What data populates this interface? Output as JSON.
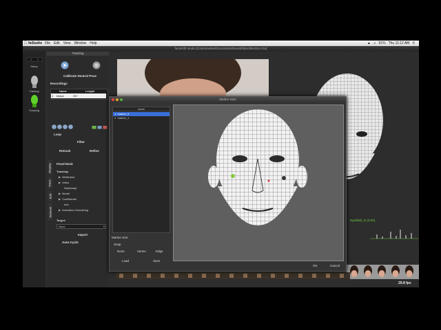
{
  "menubar": {
    "app_name": "faStudio",
    "items": [
      "File",
      "Edit",
      "View",
      "Window",
      "Help"
    ],
    "status_battery": "91%",
    "status_clock": "Thu 11:12 AM"
  },
  "window": {
    "title": "faceshift studio [/Users/weise/Documents/faceshift/profiles/Doc.fsu]"
  },
  "toolbar": {
    "setup_label": "Setup",
    "training_label": "Training",
    "tracking_label": "Tracking"
  },
  "tracking_panel": {
    "header": "Tracking",
    "calibrate_label": "Calibrate Neutral Pose",
    "recordings_label": "Recordings",
    "columns": [
      "Name",
      "Length"
    ],
    "rows": [
      {
        "index": "1",
        "name": "testpe",
        "length": "257"
      }
    ],
    "loop_label": "Loop",
    "filter_label": "Filter",
    "retrack_label": "Retrack",
    "refine_label": "Refine",
    "fixed_neck_label": "Fixed Neck",
    "tabs": [
      "Display",
      "Track",
      "Edit",
      "Network"
    ],
    "tracking_label": "Tracking:",
    "tree_items": [
      "Wireframe",
      "Video",
      "Depthmap",
      "Model",
      "Coefficients",
      "Info",
      "Animation Smoothing"
    ],
    "target_label": "Target:",
    "target_value": "None",
    "import_label": "Import",
    "auto_cycle_label": "Auto-Cycle"
  },
  "marker_dialog": {
    "title": "Marker Sets",
    "list_header": "name",
    "markers": [
      {
        "index": "1",
        "name": "marker_0",
        "selected": true
      },
      {
        "index": "2",
        "name": "marker_1",
        "selected": false
      }
    ],
    "marker_size_label": "Marker size:",
    "snap_label": "Snap",
    "snap_options": [
      "None",
      "Vertex",
      "Edge"
    ],
    "load_label": "Load",
    "save_label": "Save",
    "ok_label": "OK",
    "cancel_label": "Cancel"
  },
  "viewport": {
    "eyeblink_label": "EyeBlink_R (0.00)",
    "fps_label": "29.8 fps"
  },
  "colors": {
    "selection": "#3a6fd8",
    "graph": "#6ccf3c",
    "window_bg": "#2f2f2f"
  }
}
